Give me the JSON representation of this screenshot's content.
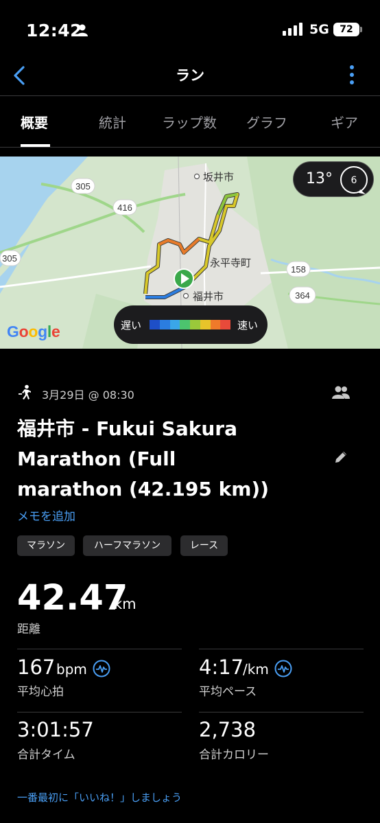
{
  "status_bar": {
    "time": "12:42",
    "network": "5G",
    "battery": "72"
  },
  "nav": {
    "title": "ラン"
  },
  "tabs": [
    {
      "label": "概要",
      "active": true
    },
    {
      "label": "統計",
      "active": false
    },
    {
      "label": "ラップ数",
      "active": false
    },
    {
      "label": "グラフ",
      "active": false
    },
    {
      "label": "ギア",
      "active": false
    }
  ],
  "map": {
    "temperature": "13°",
    "wind_speed": "6",
    "legend_slow": "遅い",
    "legend_fast": "速い",
    "legend_colors": [
      "#1e4fc7",
      "#2b7de0",
      "#3aa6e8",
      "#4cc46e",
      "#9ac93a",
      "#e8c42a",
      "#f07a2a",
      "#e84a3a"
    ],
    "places": [
      "坂井市",
      "永平寺町",
      "福井市"
    ],
    "routes": [
      "305",
      "416",
      "305",
      "158",
      "364"
    ],
    "google_logo": "Google"
  },
  "activity": {
    "date": "3月29日 @ 08:30",
    "title_lines": [
      "福井市 - Fukui Sakura",
      "Marathon (Full",
      "marathon (42.195 km))"
    ],
    "add_memo": "メモを追加",
    "tags": [
      "マラソン",
      "ハーフマラソン",
      "レース"
    ],
    "distance": "42.47",
    "distance_unit": "km",
    "distance_label": "距離"
  },
  "stats": {
    "avg_hr": "167",
    "avg_hr_unit": "bpm",
    "avg_hr_label": "平均心拍",
    "avg_pace": "4:17",
    "avg_pace_unit": "/km",
    "avg_pace_label": "平均ペース",
    "total_time": "3:01:57",
    "total_time_label": "合計タイム",
    "calories": "2,738",
    "calories_label": "合計カロリー"
  },
  "footer": {
    "like_prompt": "一番最初に「いいね！」しましょう"
  },
  "colors": {
    "accent": "#4a9ff5",
    "background": "#000000"
  }
}
